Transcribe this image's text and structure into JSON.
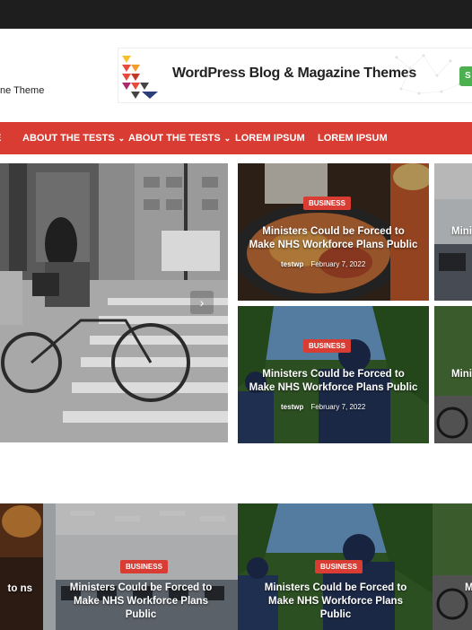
{
  "header": {
    "tagline": "ne Theme",
    "banner": {
      "text": "WordPress Blog & Magazine Themes",
      "button_label": "S"
    }
  },
  "nav": {
    "items": [
      {
        "label": "E"
      },
      {
        "label": "ABOUT THE TESTS"
      },
      {
        "label": "ABOUT THE TESTS"
      },
      {
        "label": "LOREM IPSUM"
      },
      {
        "label": "LOREM IPSUM"
      }
    ],
    "chevron": "⌄"
  },
  "slider": {
    "next_arrow": "›"
  },
  "posts": [
    {
      "category": "BUSINESS",
      "title": "Ministers Could be Forced to Make NHS Workforce Plans Public",
      "author": "testwp",
      "date": "February 7, 2022"
    },
    {
      "category": "BUSINESS",
      "title": "Ministers Could be Forced to Make NHS Workforce Plans Public",
      "author": "testwp",
      "date": "February 7, 2022"
    },
    {
      "category": "",
      "title": "Mini N",
      "author": "",
      "date": ""
    },
    {
      "category": "",
      "title": "Mini N",
      "author": "",
      "date": ""
    },
    {
      "category": "",
      "title": "to ns",
      "author": "",
      "date": ""
    },
    {
      "category": "BUSINESS",
      "title": "Ministers Could be Forced to Make NHS Workforce Plans Public",
      "author": "",
      "date": ""
    },
    {
      "category": "BUSINESS",
      "title": "Ministers Could be Forced to Make NHS Workforce Plans Public",
      "author": "",
      "date": ""
    },
    {
      "category": "",
      "title": "M",
      "author": "",
      "date": ""
    }
  ],
  "colors": {
    "accent": "#d93c32",
    "topbar": "#1e1e1e"
  }
}
